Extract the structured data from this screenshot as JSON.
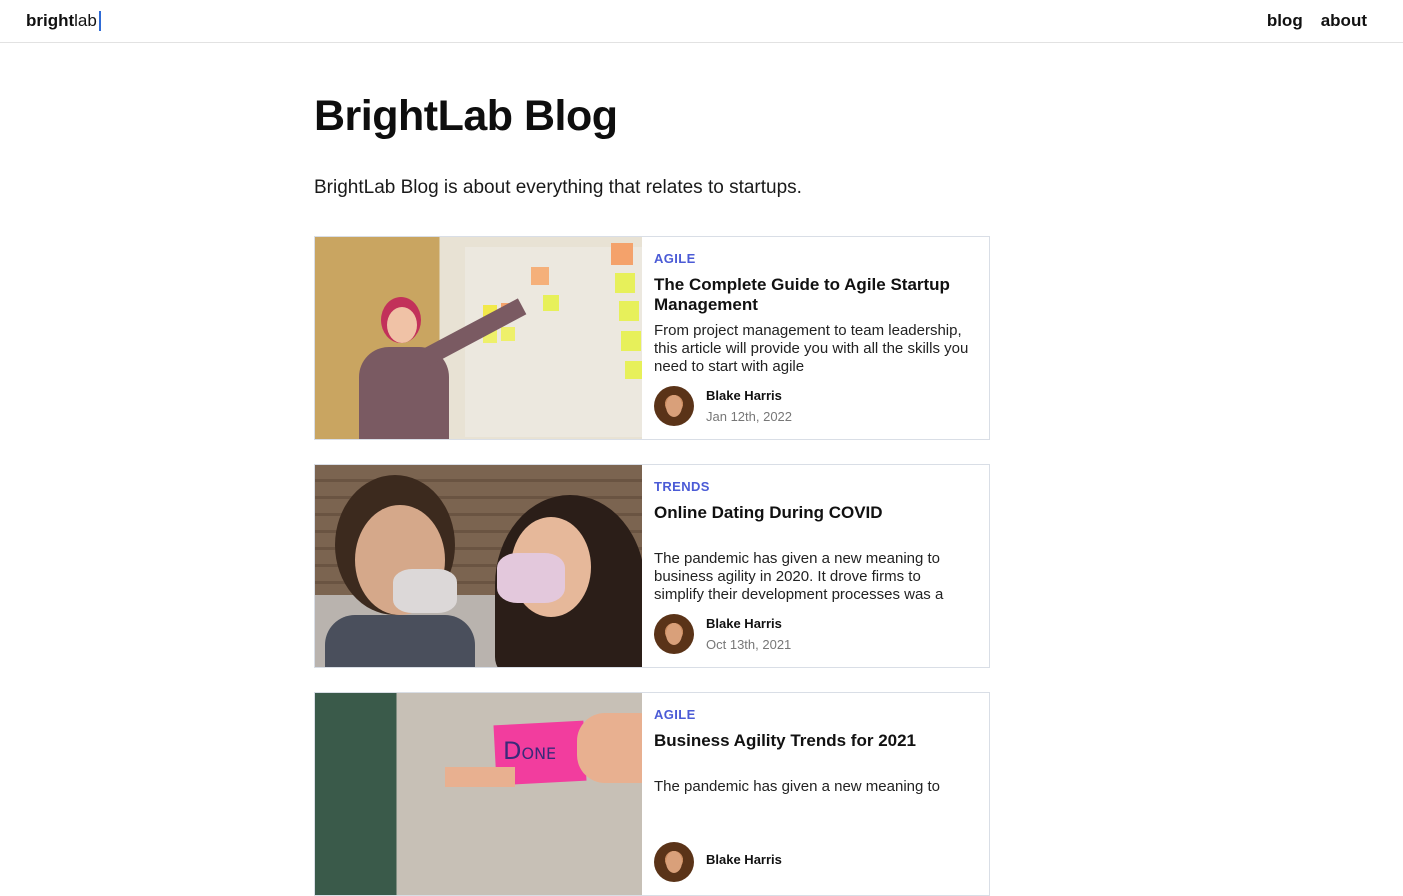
{
  "header": {
    "logo_bold": "bright",
    "logo_light": "lab",
    "nav": [
      "blog",
      "about"
    ]
  },
  "page": {
    "title": "BrightLab Blog",
    "description": "BrightLab Blog is about everything that relates to startups."
  },
  "colors": {
    "category": "#4b5bd6",
    "border": "#d9dee6",
    "caret": "#2f6bd6"
  },
  "posts": [
    {
      "category": "AGILE",
      "title": "The Complete Guide to Agile Startup Management",
      "excerpt": "From project management to team leadership, this article will provide you with all the skills you need to start with agile",
      "author": "Blake Harris",
      "date": "Jan 12th, 2022",
      "image": "woman-pointing-at-sticky-notes"
    },
    {
      "category": "TRENDS",
      "title": "Online Dating During COVID",
      "excerpt": "The pandemic has given a new meaning to business agility in 2020. It drove firms to simplify their development processes was a",
      "author": "Blake Harris",
      "date": "Oct 13th, 2021",
      "image": "couple-wearing-masks"
    },
    {
      "category": "AGILE",
      "title": "Business Agility Trends for 2021",
      "excerpt": "The pandemic has given a new meaning to",
      "author": "Blake Harris",
      "date": "",
      "image": "done-sticky-note"
    }
  ]
}
